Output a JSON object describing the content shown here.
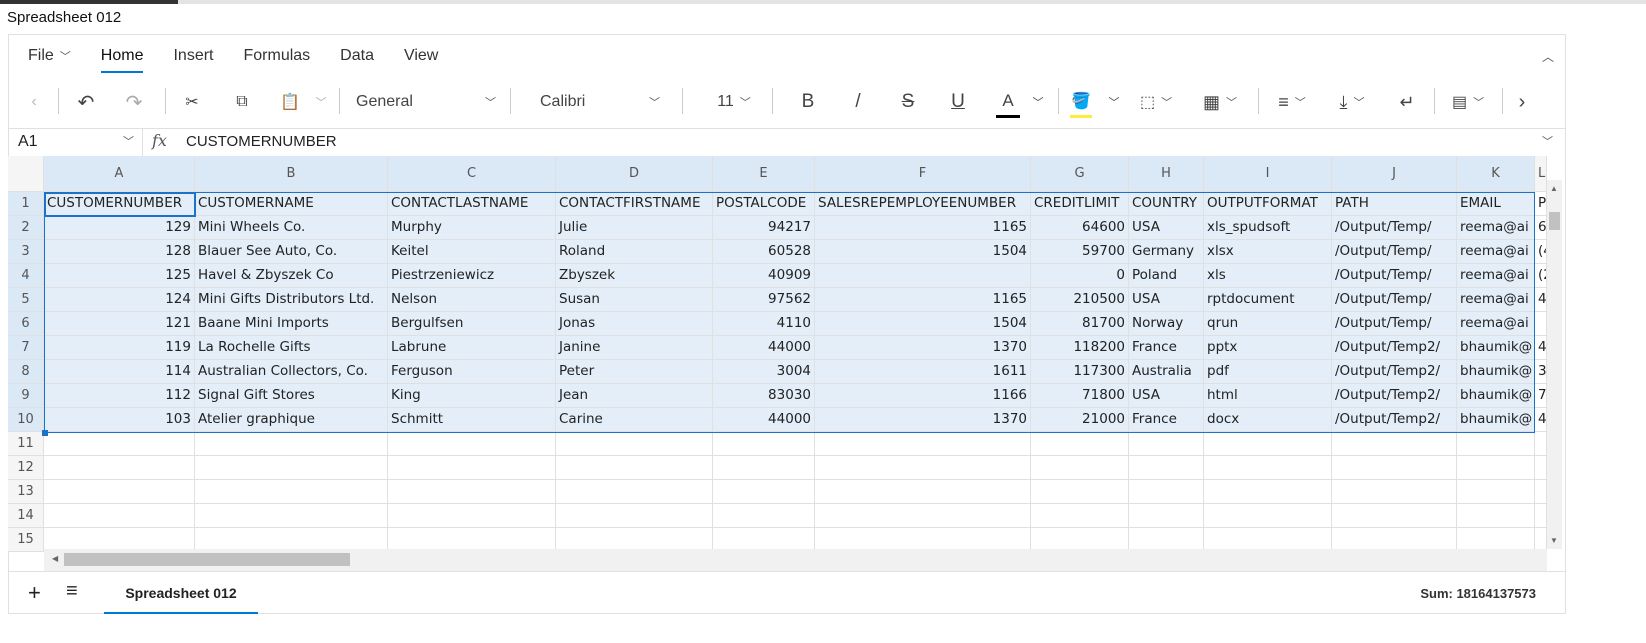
{
  "window": {
    "title": "Spreadsheet 012"
  },
  "ribbon": {
    "tabs": [
      {
        "label": "File"
      },
      {
        "label": "Home"
      },
      {
        "label": "Insert"
      },
      {
        "label": "Formulas"
      },
      {
        "label": "Data"
      },
      {
        "label": "View"
      }
    ],
    "active_tab": "Home"
  },
  "toolbar": {
    "number_format": "General",
    "font": "Calibri",
    "font_size": "11",
    "bold": "B",
    "italic": "/",
    "strike": "S",
    "underline": "U",
    "font_color": "A",
    "colors": {
      "font_color": "#000000",
      "fill_color": "#ffeb3b",
      "accent": "#0078d4"
    }
  },
  "formula_bar": {
    "name_box": "A1",
    "fx": "fx",
    "value": "CUSTOMERNUMBER"
  },
  "columns": [
    "A",
    "B",
    "C",
    "D",
    "E",
    "F",
    "G",
    "H",
    "I",
    "J",
    "K",
    "L"
  ],
  "rows": [
    [
      "CUSTOMERNUMBER",
      "CUSTOMERNAME",
      "CONTACTLASTNAME",
      "CONTACTFIRSTNAME",
      "POSTALCODE",
      "SALESREPEMPLOYEENUMBER",
      "CREDITLIMIT",
      "COUNTRY",
      "OUTPUTFORMAT",
      "PATH",
      "EMAIL",
      "P"
    ],
    [
      "129",
      "Mini Wheels Co.",
      "Murphy",
      "Julie",
      "94217",
      "1165",
      "64600",
      "USA",
      "xls_spudsoft",
      "/Output/Temp/",
      "reema@ai",
      "6"
    ],
    [
      "128",
      "Blauer See Auto, Co.",
      "Keitel",
      "Roland",
      "60528",
      "1504",
      "59700",
      "Germany",
      "xlsx",
      "/Output/Temp/",
      "reema@ai",
      "(4"
    ],
    [
      "125",
      "Havel & Zbyszek Co",
      "Piestrzeniewicz",
      "Zbyszek",
      "40909",
      "",
      "0",
      "Poland",
      "xls",
      "/Output/Temp/",
      "reema@ai",
      "(2"
    ],
    [
      "124",
      "Mini Gifts Distributors Ltd.",
      "Nelson",
      "Susan",
      "97562",
      "1165",
      "210500",
      "USA",
      "rptdocument",
      "/Output/Temp/",
      "reema@ai",
      "4"
    ],
    [
      "121",
      "Baane Mini Imports",
      "Bergulfsen",
      "Jonas",
      "4110",
      "1504",
      "81700",
      "Norway",
      "qrun",
      "/Output/Temp/",
      "reema@ai",
      ""
    ],
    [
      "119",
      "La Rochelle Gifts",
      "Labrune",
      "Janine",
      "44000",
      "1370",
      "118200",
      "France",
      "pptx",
      "/Output/Temp2/",
      "bhaumik@",
      "4"
    ],
    [
      "114",
      "Australian Collectors, Co.",
      "Ferguson",
      "Peter",
      "3004",
      "1611",
      "117300",
      "Australia",
      "pdf",
      "/Output/Temp2/",
      "bhaumik@",
      "3"
    ],
    [
      "112",
      "Signal Gift Stores",
      "King",
      "Jean",
      "83030",
      "1166",
      "71800",
      "USA",
      "html",
      "/Output/Temp2/",
      "bhaumik@",
      "7"
    ],
    [
      "103",
      "Atelier graphique",
      "Schmitt",
      "Carine",
      "44000",
      "1370",
      "21000",
      "France",
      "docx",
      "/Output/Temp2/",
      "bhaumik@",
      "4"
    ]
  ],
  "row_count_visible": 15,
  "sheet_tabs": [
    {
      "label": "Spreadsheet 012"
    }
  ],
  "status": {
    "sum": "Sum: 18164137573"
  }
}
